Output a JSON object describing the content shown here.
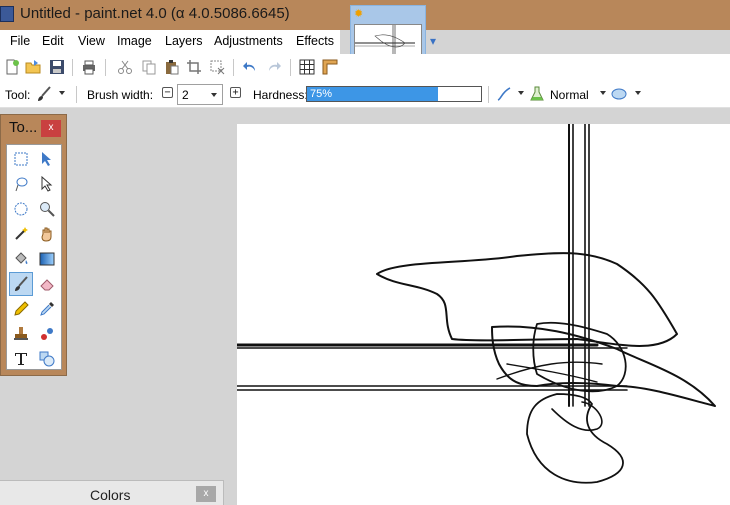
{
  "window": {
    "title": "Untitled - paint.net 4.0 (α 4.0.5086.6645)"
  },
  "menu": [
    "File",
    "Edit",
    "View",
    "Image",
    "Layers",
    "Adjustments",
    "Effects"
  ],
  "toolbar2": {
    "tool_label": "Tool:",
    "brush_width_label": "Brush width:",
    "brush_width_value": "2",
    "hardness_label": "Hardness:",
    "hardness_value": "75%",
    "hardness_fraction": 0.75,
    "blend_mode": "Normal",
    "spin_minus": "−",
    "spin_plus": "+"
  },
  "tools_window": {
    "title": "To...",
    "close": "x"
  },
  "colors_window": {
    "title": "Colors",
    "close": "x"
  },
  "colors": {
    "title_bar": "#b8875a",
    "accent": "#3d96e6",
    "close_red": "#c94040"
  },
  "icons": [
    "new-icon",
    "open-icon",
    "save-icon",
    "print-icon",
    "cut-icon",
    "copy-icon",
    "paste-icon",
    "crop-icon",
    "deselect-icon",
    "undo-icon",
    "redo-icon",
    "grid-icon",
    "ruler-icon",
    "paintbrush-icon",
    "antialias-icon",
    "alpha-blend-icon",
    "selection-mode-icon",
    "rectangle-select-icon",
    "move-selection-icon",
    "lasso-icon",
    "move-selected-icon",
    "ellipse-select-icon",
    "zoom-icon",
    "magic-wand-icon",
    "pan-icon",
    "paint-bucket-icon",
    "gradient-icon",
    "eraser-icon",
    "pencil-icon",
    "color-picker-icon",
    "clone-stamp-icon",
    "recolor-icon",
    "text-icon",
    "shapes-icon"
  ]
}
